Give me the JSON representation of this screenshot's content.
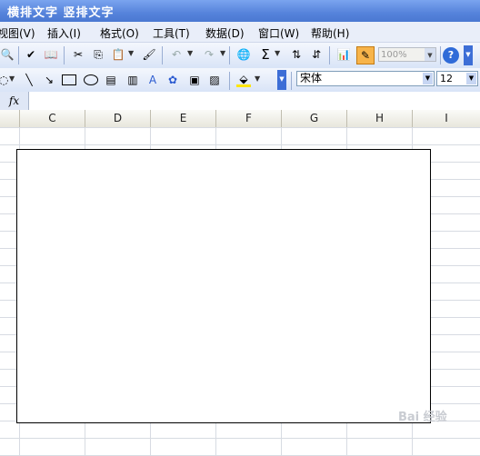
{
  "title": {
    "text": "横排文字 竖排文字"
  },
  "menu": [
    {
      "label": "视图(V)"
    },
    {
      "label": "插入(I)"
    },
    {
      "label": "格式(O)"
    },
    {
      "label": "工具(T)"
    },
    {
      "label": "数据(D)"
    },
    {
      "label": "窗口(W)"
    },
    {
      "label": "帮助(H)"
    }
  ],
  "standard_toolbar": {
    "zoom": "100%",
    "sum_symbol": "Σ",
    "help_symbol": "?"
  },
  "format_toolbar": {
    "font": "宋体",
    "font_size": "12"
  },
  "formula_bar": {
    "fx_label": "fx"
  },
  "columns": [
    "C",
    "D",
    "E",
    "F",
    "G",
    "H",
    "I"
  ],
  "watermark": {
    "text": "Bai 经验"
  }
}
